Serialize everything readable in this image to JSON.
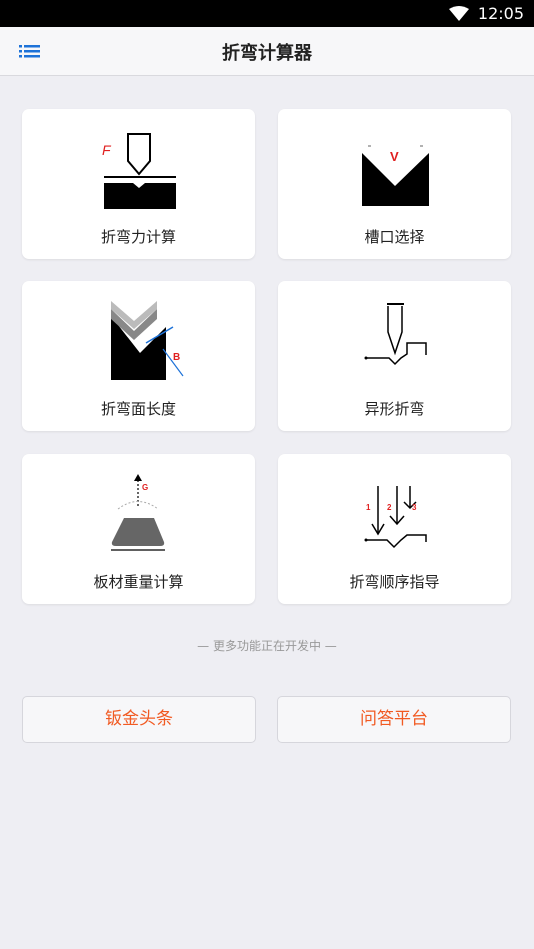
{
  "status_bar": {
    "time": "12:05",
    "wifi_icon": "wifi-icon"
  },
  "app_bar": {
    "menu_icon": "list-menu-icon",
    "title": "折弯计算器"
  },
  "cards": [
    {
      "label": "折弯力计算",
      "icon": "bending-force-icon",
      "icon_text": "F"
    },
    {
      "label": "槽口选择",
      "icon": "v-die-icon",
      "icon_text": "V"
    },
    {
      "label": "折弯面长度",
      "icon": "bend-length-icon",
      "icon_text": "B"
    },
    {
      "label": "异形折弯",
      "icon": "special-shape-bend-icon"
    },
    {
      "label": "板材重量计算",
      "icon": "plate-weight-icon",
      "icon_text": "G"
    },
    {
      "label": "折弯顺序指导",
      "icon": "bend-sequence-icon",
      "icon_text": [
        "1",
        "2",
        "3"
      ]
    }
  ],
  "more_features_text": "— 更多功能正在开发中 —",
  "bottom_buttons": {
    "left": "钣金头条",
    "right": "问答平台"
  },
  "colors": {
    "accent": "#1d72d8",
    "button_text": "#f15a22",
    "background": "#eeeef3",
    "icon_red": "#e02020"
  }
}
